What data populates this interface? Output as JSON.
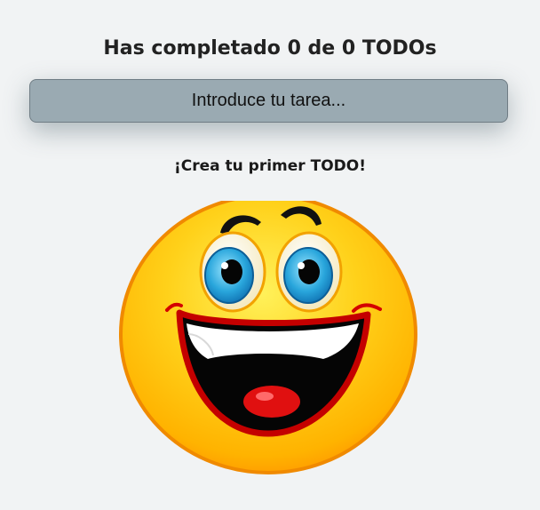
{
  "header": {
    "title": "Has completado 0 de 0 TODOs"
  },
  "task_form": {
    "placeholder": "Introduce tu tarea..."
  },
  "empty_state": {
    "message": "¡Crea tu primer TODO!",
    "illustration": "laughing-smiley-icon"
  },
  "colors": {
    "background": "#f1f3f4",
    "input_fill": "#9aaab2",
    "smiley_yellow": "#ffd21a",
    "smiley_orange": "#ff9a00",
    "eye_blue": "#2aa3d8",
    "mouth_red": "#d40000"
  }
}
